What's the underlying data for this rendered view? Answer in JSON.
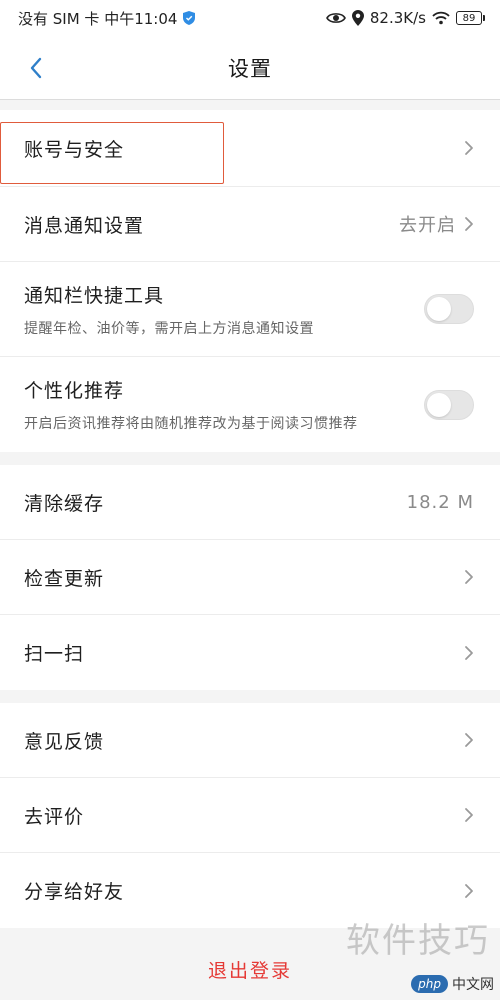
{
  "status_bar": {
    "left_text": "没有 SIM 卡 中午11:04",
    "speed": "82.3K/s",
    "battery": "89"
  },
  "nav": {
    "title": "设置"
  },
  "groups": [
    {
      "rows": [
        {
          "label": "账号与安全"
        },
        {
          "label": "消息通知设置",
          "value": "去开启"
        },
        {
          "label": "通知栏快捷工具",
          "sub": "提醒年检、油价等，需开启上方消息通知设置",
          "toggle": "off"
        },
        {
          "label": "个性化推荐",
          "sub": "开启后资讯推荐将由随机推荐改为基于阅读习惯推荐",
          "toggle": "off"
        }
      ]
    },
    {
      "rows": [
        {
          "label": "清除缓存",
          "value": "18.2 M"
        },
        {
          "label": "检查更新"
        },
        {
          "label": "扫一扫"
        }
      ]
    },
    {
      "rows": [
        {
          "label": "意见反馈"
        },
        {
          "label": "去评价"
        },
        {
          "label": "分享给好友"
        }
      ]
    }
  ],
  "logout_label": "退出登录",
  "watermark": {
    "text": "软件技巧",
    "badge_logo": "php",
    "badge_text": "中文网"
  },
  "colors": {
    "accent_blue": "#2f7fc9",
    "logout_red": "#e53935",
    "highlight_border": "#e05b3c"
  },
  "icons": {
    "back": "chevron-left-icon",
    "row_arrow": "chevron-right-icon",
    "status": [
      "shield-icon",
      "eye-icon",
      "location-pin-icon",
      "wifi-icon",
      "battery-icon"
    ]
  }
}
